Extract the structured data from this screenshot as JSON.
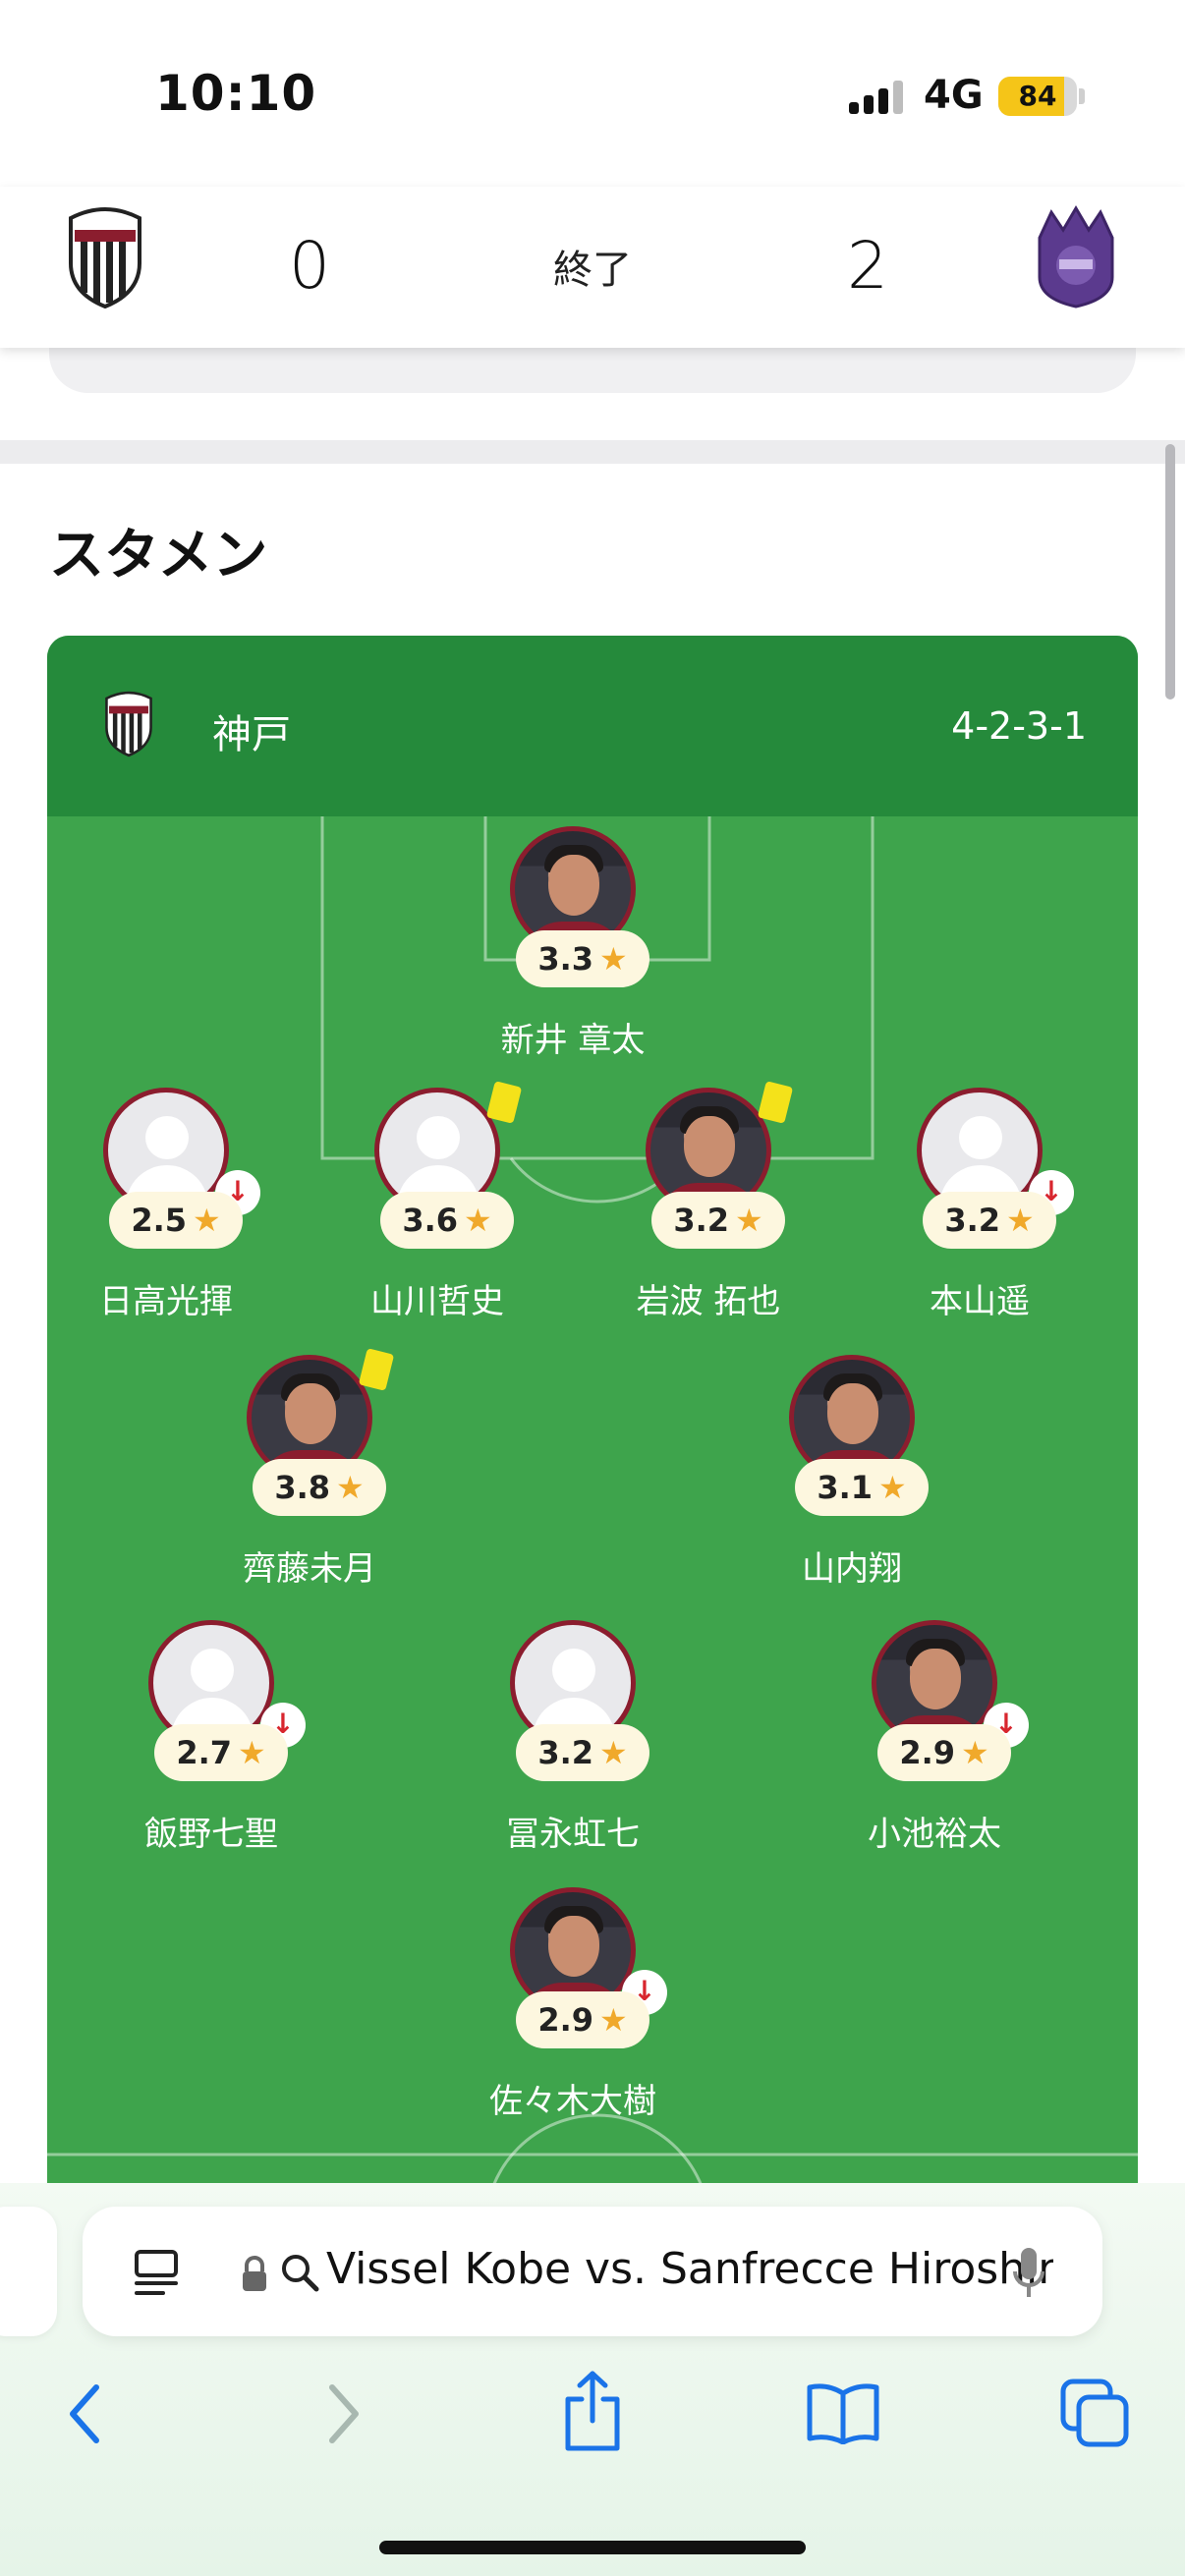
{
  "status_bar": {
    "time": "10:10",
    "network": "4G",
    "battery": "84",
    "battery_level": 0.84,
    "icons": [
      "signal-icon",
      "battery-icon"
    ]
  },
  "score_header": {
    "home_score": "0",
    "away_score": "2",
    "status": "終了",
    "icons": [
      "vissel-kobe-crest-icon",
      "sanfrecce-hiroshima-crest-icon"
    ]
  },
  "section": {
    "title": "スタメン"
  },
  "lineup": {
    "team_name": "神戸",
    "formation": "4-2-3-1",
    "accent": "#258a3b",
    "pitch_color": "#3ea44c",
    "players": [
      {
        "name": "新井 章太",
        "rating": "3.3",
        "photo": true,
        "sub": false,
        "yellow": false
      },
      {
        "name": "日高光揮",
        "rating": "2.5",
        "photo": false,
        "sub": true,
        "yellow": false
      },
      {
        "name": "山川哲史",
        "rating": "3.6",
        "photo": false,
        "sub": false,
        "yellow": true
      },
      {
        "name": "岩波 拓也",
        "rating": "3.2",
        "photo": true,
        "sub": false,
        "yellow": true
      },
      {
        "name": "本山遥",
        "rating": "3.2",
        "photo": false,
        "sub": true,
        "yellow": false
      },
      {
        "name": "齊藤未月",
        "rating": "3.8",
        "photo": true,
        "sub": false,
        "yellow": true
      },
      {
        "name": "山内翔",
        "rating": "3.1",
        "photo": true,
        "sub": false,
        "yellow": false
      },
      {
        "name": "飯野七聖",
        "rating": "2.7",
        "photo": false,
        "sub": true,
        "yellow": false
      },
      {
        "name": "冨永虹七",
        "rating": "3.2",
        "photo": false,
        "sub": false,
        "yellow": false
      },
      {
        "name": "小池裕太",
        "rating": "2.9",
        "photo": true,
        "sub": true,
        "yellow": false
      },
      {
        "name": "佐々木大樹",
        "rating": "2.9",
        "photo": true,
        "sub": true,
        "yellow": false
      }
    ]
  },
  "browser": {
    "address": "Vissel Kobe vs. Sanfrecce Hiroshima",
    "icons": [
      "reader-icon",
      "lock-icon",
      "search-icon",
      "microphone-icon",
      "back-icon",
      "forward-icon",
      "share-icon",
      "bookmarks-icon",
      "tabs-icon"
    ]
  }
}
